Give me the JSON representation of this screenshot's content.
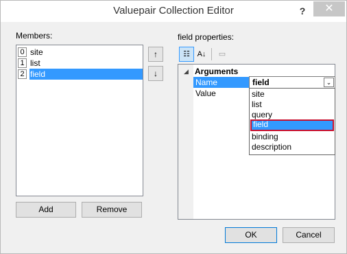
{
  "window": {
    "title": "Valuepair Collection Editor",
    "help_label": "?",
    "close_label": "✕"
  },
  "members": {
    "label": "Members:",
    "items": [
      {
        "index": "0",
        "name": "site",
        "selected": false
      },
      {
        "index": "1",
        "name": "list",
        "selected": false
      },
      {
        "index": "2",
        "name": "field",
        "selected": true
      }
    ],
    "move_up_icon": "↑",
    "move_down_icon": "↓",
    "add_label": "Add",
    "remove_label": "Remove"
  },
  "properties": {
    "label": "field properties:",
    "toolbar": {
      "categorized_glyph": "☷",
      "alphabetical_glyph": "A↓",
      "pages_glyph": "▭"
    },
    "category": {
      "expand_glyph": "◢",
      "label": "Arguments"
    },
    "rows": [
      {
        "name": "Name",
        "value": "field",
        "selected": true
      },
      {
        "name": "Value",
        "value": "",
        "selected": false
      }
    ],
    "combo_arrow": "⌄",
    "dropdown_options": [
      "site",
      "list",
      "query",
      "field",
      "binding",
      "description"
    ],
    "dropdown_selected": "field"
  },
  "footer": {
    "ok_label": "OK",
    "cancel_label": "Cancel"
  },
  "colors": {
    "selection": "#3399ff",
    "highlight_border": "#c8102e"
  }
}
